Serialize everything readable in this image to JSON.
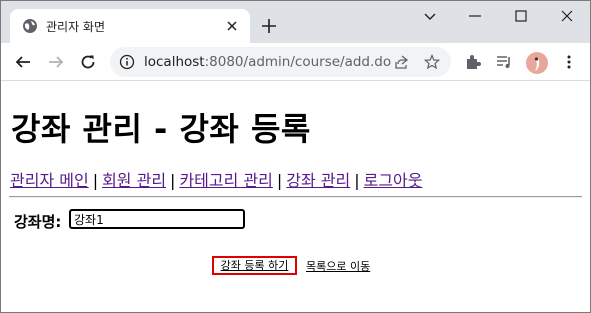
{
  "browser": {
    "tab_title": "관리자 화면",
    "url_host": "localhost",
    "url_path": ":8080/admin/course/add.do"
  },
  "page": {
    "title": "강좌 관리 - 강좌 등록",
    "nav": [
      {
        "label": "관리자 메인"
      },
      {
        "label": "회원 관리"
      },
      {
        "label": "카테고리 관리"
      },
      {
        "label": "강좌 관리"
      },
      {
        "label": "로그아웃"
      }
    ],
    "nav_separator": "|",
    "form": {
      "course_name_label": "강좌명:",
      "course_name_value": "강좌1"
    },
    "actions": {
      "submit_label": "강좌 등록 하기",
      "list_label": "목록으로 이동"
    }
  },
  "colors": {
    "highlight_border": "#e00000",
    "visited_link": "#551a8b"
  }
}
